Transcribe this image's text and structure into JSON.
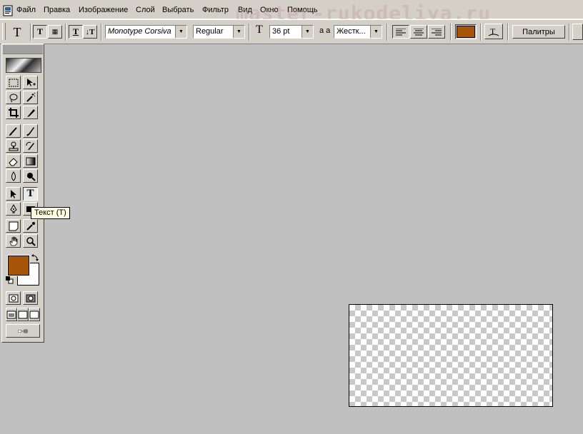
{
  "menu": {
    "items": [
      {
        "label": "Файл"
      },
      {
        "label": "Правка"
      },
      {
        "label": "Изображение"
      },
      {
        "label": "Слой"
      },
      {
        "label": "Выбрать"
      },
      {
        "label": "Фильтр"
      },
      {
        "label": "Вид"
      },
      {
        "label": "Окно"
      },
      {
        "label": "Помощь"
      }
    ]
  },
  "watermark": "master-rukodeliya.ru",
  "options": {
    "tool_glyph": "T",
    "font_family": "Monotype Corsiva",
    "font_style": "Regular",
    "font_size": "36 pt",
    "antialias": "Жестк...",
    "text_color": "#a65407",
    "palettes_label": "Палитры",
    "size_glyph": "T",
    "aa_glyph": "a a"
  },
  "toolbox": {
    "tooltip": "Текст     (T)",
    "foreground_color": "#a65407",
    "background_color": "#ffffff"
  }
}
